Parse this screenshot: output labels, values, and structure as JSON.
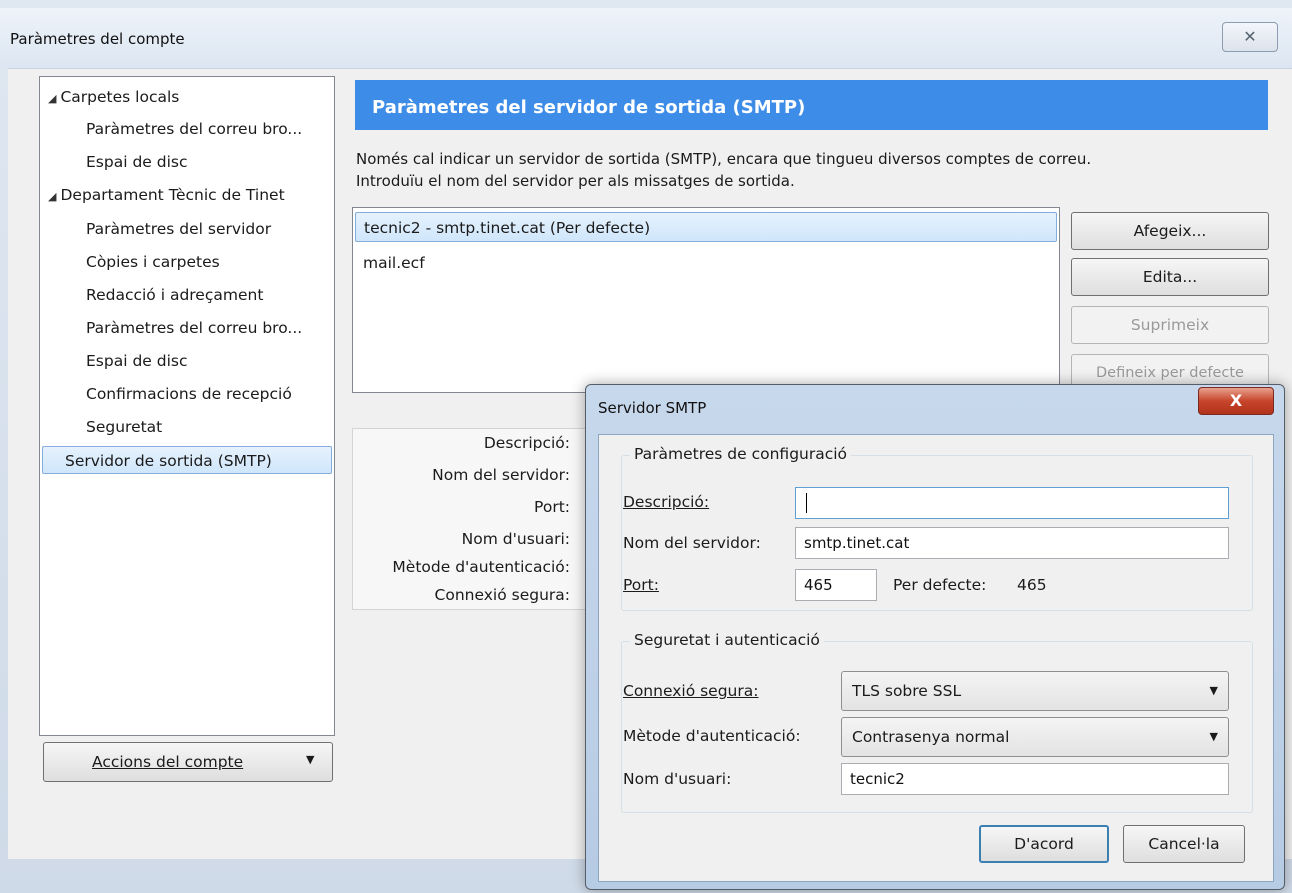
{
  "main_window": {
    "title": "Paràmetres del compte",
    "close_icon": "✕"
  },
  "tree": [
    {
      "label": "Carpetes locals",
      "level": 0,
      "expanded": true
    },
    {
      "label": "Paràmetres del correu bro...",
      "level": 1
    },
    {
      "label": "Espai de disc",
      "level": 1
    },
    {
      "label": "Departament Tècnic de Tinet",
      "level": 0,
      "expanded": true
    },
    {
      "label": "Paràmetres del servidor",
      "level": 1
    },
    {
      "label": "Còpies i carpetes",
      "level": 1
    },
    {
      "label": "Redacció i adreçament",
      "level": 1
    },
    {
      "label": "Paràmetres del correu bro...",
      "level": 1
    },
    {
      "label": "Espai de disc",
      "level": 1
    },
    {
      "label": "Confirmacions de recepció",
      "level": 1
    },
    {
      "label": "Seguretat",
      "level": 1
    },
    {
      "label": "Servidor de sortida (SMTP)",
      "level": 0,
      "selected": true
    }
  ],
  "account_actions": {
    "label": "Accions del compte"
  },
  "panel": {
    "header": "Paràmetres del servidor de sortida (SMTP)",
    "intro_line1": "Només cal indicar un servidor de sortida (SMTP), encara que tingueu diversos comptes de correu.",
    "intro_line2": "Introduïu el nom del servidor per als missatges de sortida.",
    "servers": [
      {
        "label": "tecnic2 - smtp.tinet.cat (Per defecte)",
        "selected": true
      },
      {
        "label": "mail.ecf",
        "selected": false
      }
    ],
    "buttons": {
      "add": "Afegeix...",
      "edit": "Edita...",
      "remove": "Suprimeix",
      "set_default": "Defineix per defecte"
    },
    "details": {
      "description": "Descripció:",
      "server_name": "Nom del servidor:",
      "port": "Port:",
      "username": "Nom d'usuari:",
      "auth_method": "Mètode d'autenticació:",
      "secure_connection": "Connexió segura:"
    }
  },
  "dialog": {
    "title": "Servidor SMTP",
    "close_icon": "X",
    "config_group": {
      "legend": "Paràmetres de configuració",
      "description_label": "Descripció:",
      "description_value": "",
      "server_label": "Nom del servidor:",
      "server_value": "smtp.tinet.cat",
      "port_label": "Port:",
      "port_value": "465",
      "default_port_label": "Per defecte:",
      "default_port_value": "465"
    },
    "security_group": {
      "legend": "Seguretat i autenticació",
      "connection_label": "Connexió segura:",
      "connection_value": "TLS sobre SSL",
      "auth_label": "Mètode d'autenticació:",
      "auth_value": "Contrasenya normal",
      "username_label": "Nom d'usuari:",
      "username_value": "tecnic2"
    },
    "ok": "D'acord",
    "cancel": "Cancel·la"
  }
}
